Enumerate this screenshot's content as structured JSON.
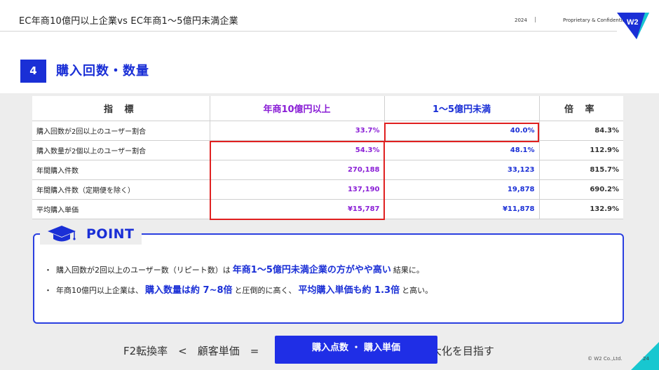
{
  "header": {
    "title": "EC年商10億円以上企業vs EC年商1〜5億円未満企業",
    "year": "2024",
    "separator": "|",
    "confidential": "Proprietary & Confidential",
    "logo_text": "W2"
  },
  "section": {
    "number": "4",
    "title": "購入回数・数量"
  },
  "table": {
    "headers": [
      "指 標",
      "年商10億円以上",
      "1〜5億円未満",
      "倍 率"
    ],
    "rows": [
      {
        "label": "購入回数が2回以上のユーザー割合",
        "large": "33.7%",
        "small": "40.0%",
        "ratio": "84.3%"
      },
      {
        "label": "購入数量が2個以上のユーザー割合",
        "large": "54.3%",
        "small": "48.1%",
        "ratio": "112.9%"
      },
      {
        "label": "年間購入件数",
        "large": "270,188",
        "small": "33,123",
        "ratio": "815.7%"
      },
      {
        "label": "年間購入件数（定期便を除く）",
        "large": "137,190",
        "small": "19,878",
        "ratio": "690.2%"
      },
      {
        "label": "平均購入単価",
        "large": "¥15,787",
        "small": "¥11,878",
        "ratio": "132.9%"
      }
    ]
  },
  "point": {
    "label": "POINT",
    "bullet1": {
      "dot": "・",
      "pre": "購入回数が2回以上のユーザー数（リピート数）は",
      "highlight": "年商1〜5億円未満企業の方がやや高い",
      "post": "結果に。"
    },
    "bullet2": {
      "dot": "・",
      "pre": "年商10億円以上企業は、",
      "highlight1": "購入数量は約 7~8倍",
      "mid": "と圧倒的に高く、",
      "highlight2": "平均購入単価も約 1.3倍",
      "post": "と高い。"
    }
  },
  "footer": {
    "formula_left": "F2転換率　<　顧客単価　=",
    "formula_right": "大化を目指す",
    "button_label": "購入点数 ・ 購入単価",
    "copyright": "© W2 Co.,Ltd.",
    "page": "24"
  },
  "colors": {
    "brand_blue": "#1a2fd6",
    "purple": "#8a1fd6",
    "highlight_red": "#e02020",
    "accent_cyan": "#17c7d0"
  }
}
